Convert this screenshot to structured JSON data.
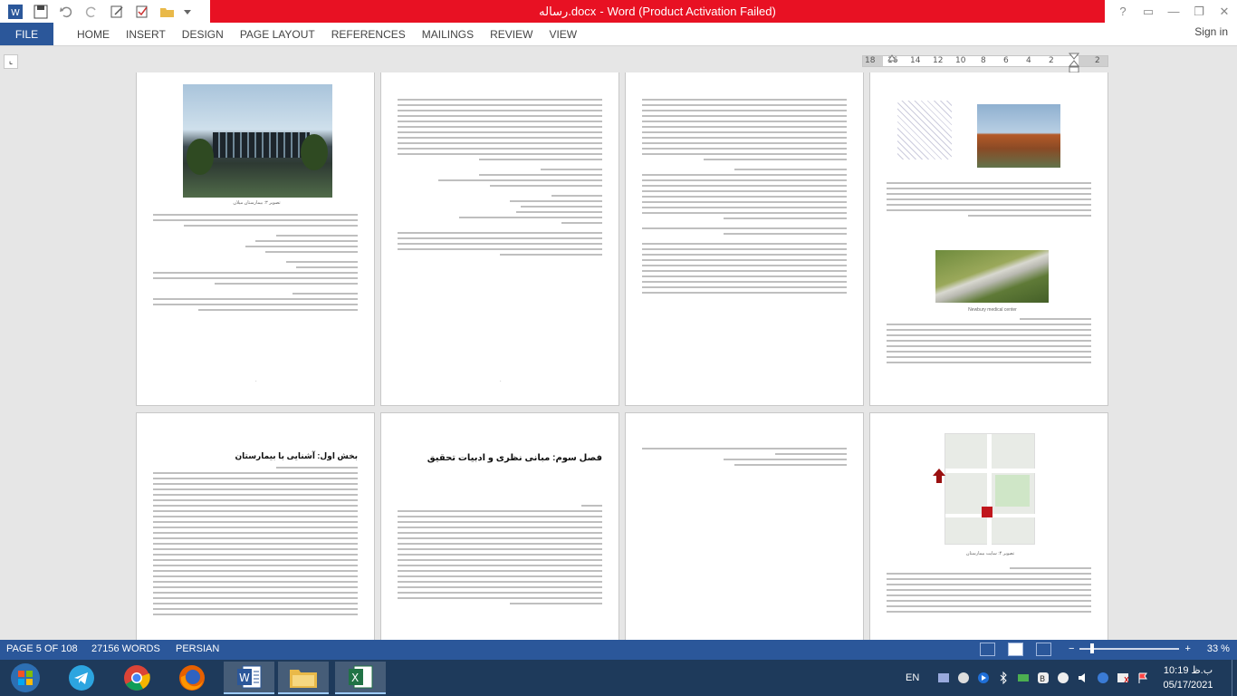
{
  "window": {
    "title_filename": "رساله.docx",
    "title_separator": "-",
    "title_app": "Word (Product Activation Failed)",
    "controls": {
      "help": "?",
      "ribbon_options": "▭",
      "minimize": "—",
      "restore": "❐",
      "close": "✕"
    }
  },
  "ribbon": {
    "file_label": "FILE",
    "tabs": [
      "HOME",
      "INSERT",
      "DESIGN",
      "PAGE LAYOUT",
      "REFERENCES",
      "MAILINGS",
      "REVIEW",
      "VIEW"
    ],
    "signin_label": "Sign in"
  },
  "ruler": {
    "ticks": [
      "18",
      "16",
      "14",
      "12",
      "10",
      "8",
      "6",
      "4",
      "2",
      "",
      "2"
    ]
  },
  "pages": {
    "p1_heading": "فصل سوم: مبانی نظری و ادبیات تحقیق",
    "p2_heading": "بخش اول: آشنایی با بیمارستان",
    "figure_caption_1": "تصویر ۳: بیمارستان میلان",
    "figure_caption_2": "Newbury medical center",
    "map_caption": "تصویر ۴: سایت بیمارستان"
  },
  "status": {
    "page": "PAGE 5 OF 108",
    "words": "27156 WORDS",
    "language": "PERSIAN",
    "zoom_minus": "−",
    "zoom_plus": "+",
    "zoom_value": "33 %",
    "zoom_fraction": 0.33
  },
  "taskbar": {
    "lang": "EN",
    "time": "10:19 ب.ظ",
    "date": "05/17/2021",
    "apps": [
      "start-orb",
      "telegram",
      "chrome",
      "firefox",
      "word",
      "file-explorer",
      "excel"
    ]
  },
  "colors": {
    "word_blue": "#2b579a",
    "title_red": "#e81123",
    "taskbar": "#1e3a5b"
  }
}
